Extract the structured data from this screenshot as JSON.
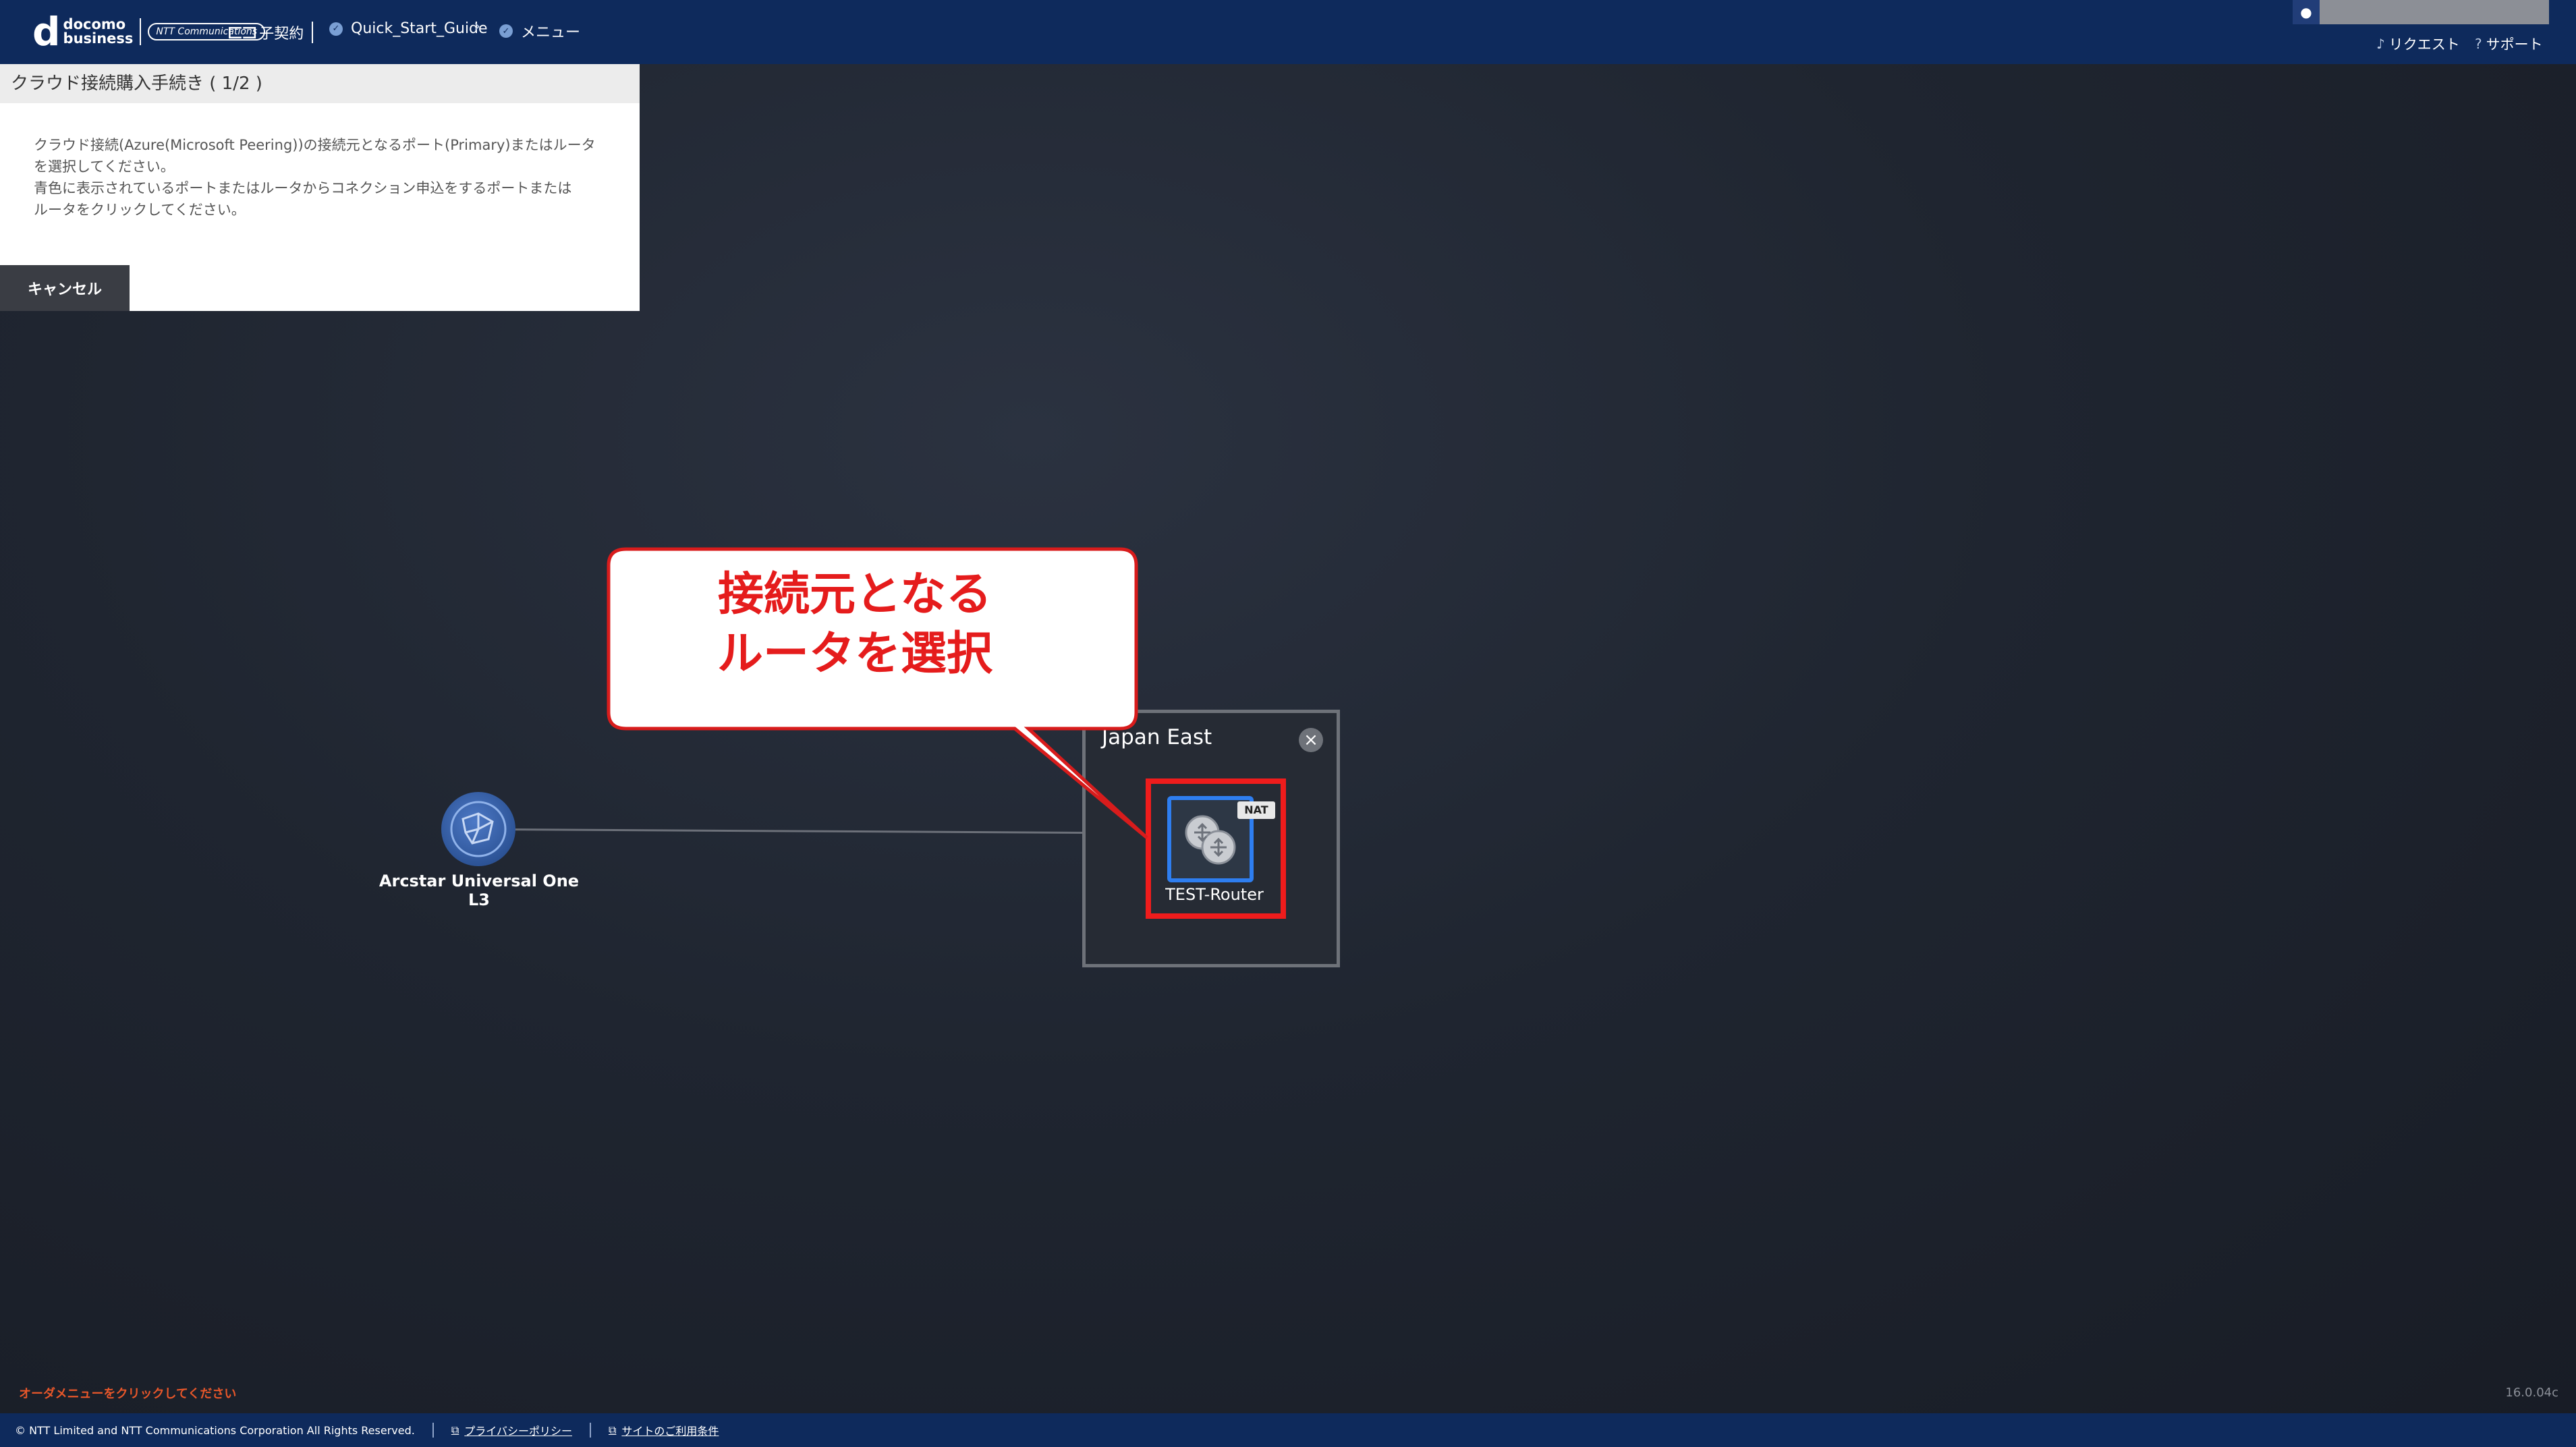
{
  "header": {
    "logo_mark": "d",
    "logo_line1": "docomo",
    "logo_line2": "business",
    "logo_partner": "NTT Communications",
    "child_contract": "子契約",
    "breadcrumb": [
      {
        "label": "Quick_Start_Guide"
      },
      {
        "label": "メニュー"
      }
    ],
    "request_label": "リクエスト",
    "support_label": "サポート"
  },
  "panel": {
    "title": "クラウド接続購入手続き ( 1/2 )",
    "line1": "クラウド接続(Azure(Microsoft Peering))の接続元となるポート(Primary)またはルータ",
    "line2": "を選択してください。",
    "line3": "青色に表示されているポートまたはルータからコネクション申込をするポートまたは",
    "line4": "ルータをクリックしてください。",
    "cancel_label": "キャンセル"
  },
  "topology": {
    "network_label": "Arcstar Universal One L3",
    "region_title": "Japan East",
    "router_label": "TEST-Router",
    "router_badge": "NAT"
  },
  "callout": {
    "line1": "接続元となる",
    "line2": "ルータを選択"
  },
  "bottom": {
    "order_hint": "オーダメニューをクリックしてください",
    "version": "16.0.04c"
  },
  "footer": {
    "copyright": "© NTT Limited and NTT Communications Corporation All Rights Reserved.",
    "privacy_label": "プライバシーポリシー",
    "terms_label": "サイトのご利用条件"
  },
  "colors": {
    "header_bg": "#0e2a5c",
    "highlight_red": "#ef1c1c",
    "router_blue": "#2e7ef0",
    "callout_text": "#e51c1c",
    "order_hint": "#e8572a"
  },
  "icons": [
    "user-icon",
    "bell-icon",
    "question-icon",
    "tree-icon",
    "check-circle-icon",
    "chevron-right-icon",
    "globe-network-icon",
    "router-icon",
    "close-icon",
    "external-link-icon"
  ]
}
